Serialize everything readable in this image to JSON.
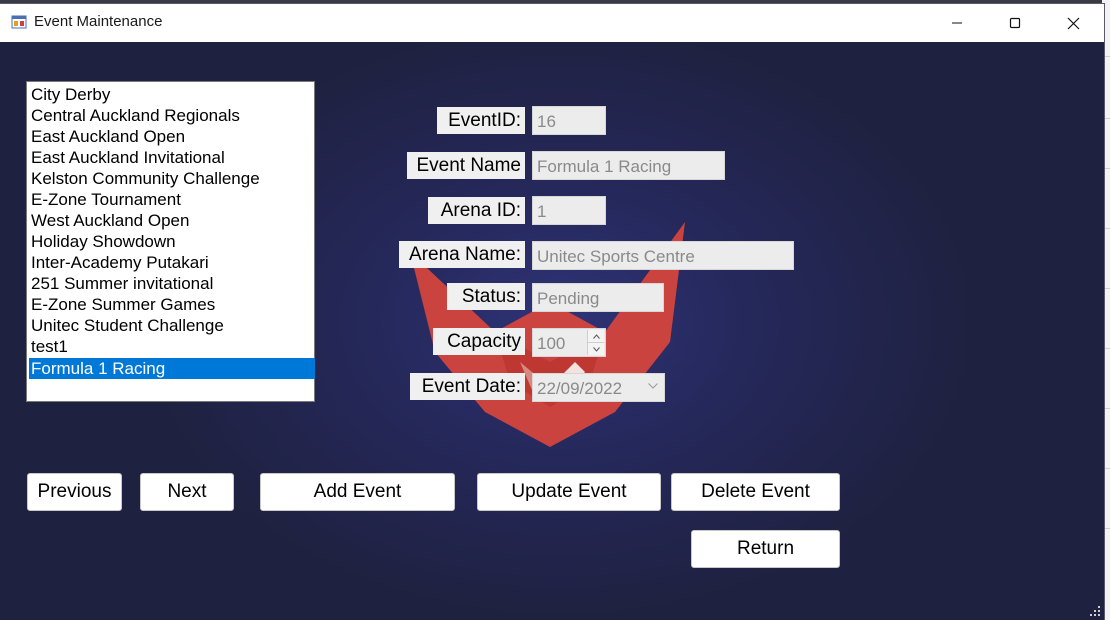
{
  "window": {
    "title": "Event Maintenance"
  },
  "events_list": {
    "items": [
      "City Derby",
      "Central Auckland Regionals",
      "East Auckland Open",
      "East Auckland Invitational",
      "Kelston Community Challenge",
      "E-Zone Tournament",
      "West Auckland Open",
      "Holiday Showdown",
      "Inter-Academy Putakari",
      "251 Summer invitational",
      "E-Zone Summer Games",
      "Unitec Student Challenge",
      "test1",
      "Formula 1 Racing"
    ],
    "selected": "Formula 1 Racing"
  },
  "form": {
    "event_id_label": "EventID:",
    "event_id_value": "16",
    "event_name_label": "Event Name",
    "event_name_value": "Formula 1 Racing",
    "arena_id_label": "Arena ID:",
    "arena_id_value": "1",
    "arena_name_label": "Arena Name:",
    "arena_name_value": "Unitec Sports Centre",
    "status_label": "Status:",
    "status_value": "Pending",
    "capacity_label": "Capacity",
    "capacity_value": "100",
    "event_date_label": "Event Date:",
    "event_date_value": "22/09/2022"
  },
  "buttons": {
    "previous": "Previous",
    "next": "Next",
    "add_event": "Add Event",
    "update_event": "Update Event",
    "delete_event": "Delete Event",
    "return": "Return"
  },
  "icons": {
    "app": "app-window-icon",
    "minimize": "minimize-icon",
    "maximize": "maximize-icon",
    "close": "close-icon",
    "logo": "red-fox-logo"
  },
  "colors": {
    "selection": "#0078d7",
    "client_bg": "#242645",
    "logo_red": "#d9453c"
  }
}
